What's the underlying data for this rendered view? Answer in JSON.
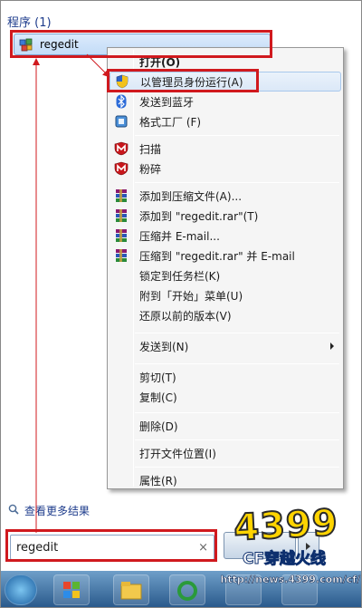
{
  "start_menu": {
    "section_header": "程序 (1)",
    "result_item": {
      "label": "regedit"
    },
    "see_more": "查看更多结果",
    "search": {
      "value": "regedit",
      "clear_glyph": "×"
    }
  },
  "context_menu": {
    "items": [
      {
        "label": "打开(O)",
        "bold": true,
        "icon": "none"
      },
      {
        "label": "以管理员身份运行(A)",
        "icon": "uac-shield-icon"
      },
      {
        "label": "发送到蓝牙",
        "icon": "bluetooth-icon"
      },
      {
        "label": "格式工厂 (F)",
        "icon": "format-factory-icon"
      },
      {
        "label": "扫描",
        "icon": "mcafee-shield-icon"
      },
      {
        "label": "粉碎",
        "icon": "mcafee-shield-icon"
      },
      {
        "label": "添加到压缩文件(A)...",
        "icon": "winrar-icon"
      },
      {
        "label": "添加到 \"regedit.rar\"(T)",
        "icon": "winrar-icon"
      },
      {
        "label": "压缩并 E-mail...",
        "icon": "winrar-icon"
      },
      {
        "label": "压缩到 \"regedit.rar\" 并 E-mail",
        "icon": "winrar-icon"
      },
      {
        "label": "锁定到任务栏(K)",
        "icon": "none"
      },
      {
        "label": "附到「开始」菜单(U)",
        "icon": "none"
      },
      {
        "label": "还原以前的版本(V)",
        "icon": "none"
      },
      {
        "label": "发送到(N)",
        "icon": "none",
        "submenu": true
      },
      {
        "label": "剪切(T)",
        "icon": "none"
      },
      {
        "label": "复制(C)",
        "icon": "none"
      },
      {
        "label": "删除(D)",
        "icon": "none"
      },
      {
        "label": "打开文件位置(I)",
        "icon": "none"
      },
      {
        "label": "属性(R)",
        "icon": "none"
      }
    ]
  },
  "watermark": {
    "logo": "4399",
    "subtitle": "CF穿越火线",
    "url": "http://news.4399.com/cf/"
  },
  "colors": {
    "annotation_red": "#d0191e",
    "header_blue": "#1e3c8c",
    "menu_bg": "#f5f5f5"
  }
}
